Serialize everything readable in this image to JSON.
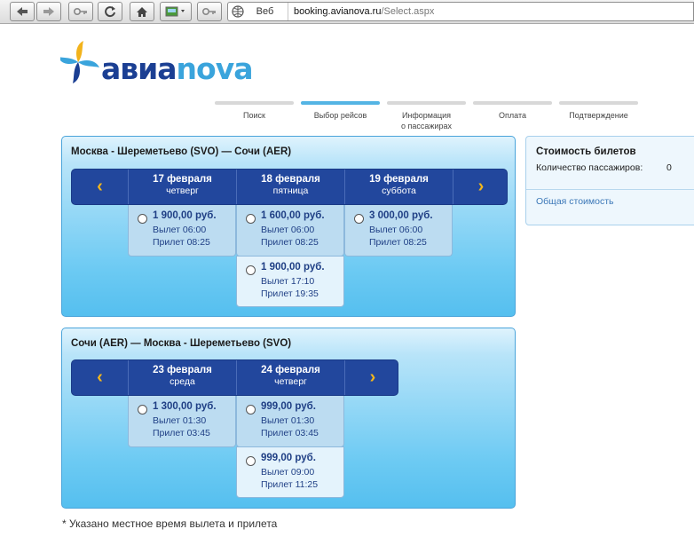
{
  "browser": {
    "tab_label": "Веб",
    "url_host": "booking.avianova.ru",
    "url_path": "/Select.aspx"
  },
  "logo": {
    "part1": "авиа",
    "part2": "nova"
  },
  "steps": [
    {
      "label": "Поиск"
    },
    {
      "label": "Выбор рейсов",
      "active": true
    },
    {
      "label": "Информация\nо пассажирах"
    },
    {
      "label": "Оплата"
    },
    {
      "label": "Подтверждение"
    }
  ],
  "outbound": {
    "title": "Москва - Шереметьево (SVO) — Сочи (AER)",
    "dates": [
      {
        "date": "17 февраля",
        "weekday": "четверг"
      },
      {
        "date": "18 февраля",
        "weekday": "пятница"
      },
      {
        "date": "19 февраля",
        "weekday": "суббота"
      }
    ],
    "fares": [
      {
        "col": 0,
        "row": 0,
        "price": "1 900,00 руб.",
        "dep": "Вылет 06:00",
        "arr": "Прилет 08:25"
      },
      {
        "col": 1,
        "row": 0,
        "price": "1 600,00 руб.",
        "dep": "Вылет 06:00",
        "arr": "Прилет 08:25"
      },
      {
        "col": 2,
        "row": 0,
        "price": "3 000,00 руб.",
        "dep": "Вылет 06:00",
        "arr": "Прилет 08:25"
      },
      {
        "col": 1,
        "row": 1,
        "price": "1 900,00 руб.",
        "dep": "Вылет 17:10",
        "arr": "Прилет 19:35"
      }
    ]
  },
  "return": {
    "title": "Сочи (AER) — Москва - Шереметьево (SVO)",
    "dates": [
      {
        "date": "23 февраля",
        "weekday": "среда"
      },
      {
        "date": "24 февраля",
        "weekday": "четверг"
      }
    ],
    "fares": [
      {
        "col": 0,
        "row": 0,
        "price": "1 300,00 руб.",
        "dep": "Вылет 01:30",
        "arr": "Прилет 03:45"
      },
      {
        "col": 1,
        "row": 0,
        "price": "999,00 руб.",
        "dep": "Вылет 01:30",
        "arr": "Прилет 03:45"
      },
      {
        "col": 1,
        "row": 1,
        "price": "999,00 руб.",
        "dep": "Вылет 09:00",
        "arr": "Прилет 11:25"
      }
    ]
  },
  "summary": {
    "title": "Стоимость билетов",
    "passengers_label": "Количество пассажиров:",
    "passengers_value": "0",
    "total_label": "Общая стоимость"
  },
  "footnote": "* Указано местное время вылета и прилета",
  "colors": {
    "brand_dark": "#1b3f93",
    "brand_light": "#3aa4dc",
    "date_bar": "#22479d",
    "arrow": "#f4b71b"
  }
}
